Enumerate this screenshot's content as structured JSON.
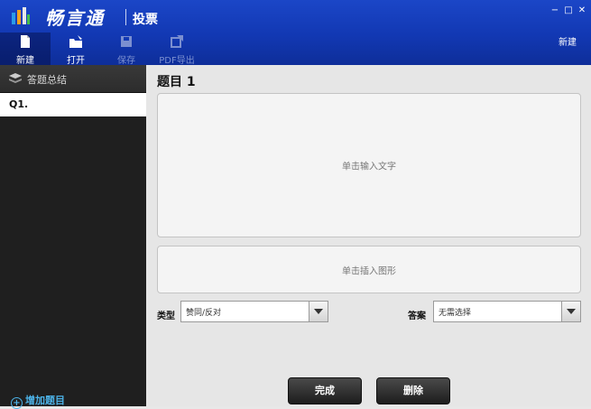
{
  "app": {
    "logo_text": "畅言通",
    "title": "投票",
    "window_buttons": [
      "−",
      "□",
      "✕"
    ]
  },
  "toolbar": {
    "items": [
      {
        "label": "新建",
        "icon": "new-file-icon",
        "state": "active"
      },
      {
        "label": "打开",
        "icon": "open-folder-icon",
        "state": "enabled"
      },
      {
        "label": "保存",
        "icon": "save-disk-icon",
        "state": "disabled"
      },
      {
        "label": "PDF导出",
        "icon": "export-icon",
        "state": "disabled"
      }
    ],
    "right_label": "新建"
  },
  "sidebar": {
    "header": "答题总结",
    "questions": [
      "Q1."
    ],
    "add_label": "增加题目"
  },
  "main": {
    "topic_title": "题目 1",
    "text_placeholder": "单击输入文字",
    "image_placeholder": "单击插入图形",
    "type_label": "类型",
    "type_value": "赞同/反对",
    "answer_label": "答案",
    "answer_value": "无需选择",
    "done_button": "完成",
    "delete_button": "删除"
  },
  "colors": {
    "topbar": "#1238b3",
    "sidebar": "#1f1f1f",
    "accent": "#4cb3e8"
  }
}
